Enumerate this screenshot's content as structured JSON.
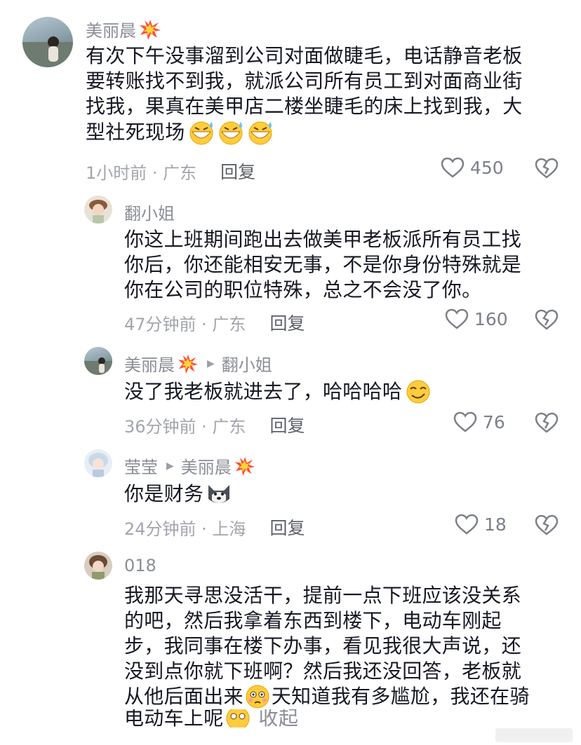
{
  "comments": [
    {
      "name": "美丽晨",
      "name_emoji": "boom-icon",
      "text_lines": [
        "有次下午没事溜到公司对面做睫毛，电话静音老板",
        "要转账找不到我，就派公司所有员工到对面商业街",
        "找我，果真在美甲店二楼坐睫毛的床上找到我，大",
        "型社死现场"
      ],
      "time": "1小时前 · 广东",
      "reply": "回复",
      "likes": "450"
    },
    {
      "name": "翻小姐",
      "text_lines": [
        "你这上班期间跑出去做美甲老板派所有员工找",
        "你后，你还能相安无事，不是你身份特殊就是",
        "你在公司的职位特殊，总之不会没了你。"
      ],
      "time": "47分钟前 · 广东",
      "reply": "回复",
      "likes": "160"
    },
    {
      "name": "美丽晨",
      "reply_to": "翻小姐",
      "text_lines": [
        "没了我老板就进去了，哈哈哈哈"
      ],
      "time": "36分钟前 · 广东",
      "reply": "回复",
      "likes": "76"
    },
    {
      "name": "莹莹",
      "reply_to": "美丽晨",
      "text_lines": [
        "你是财务"
      ],
      "time": "24分钟前 · 上海",
      "reply": "回复",
      "likes": "18"
    },
    {
      "name": "018",
      "text_lines": [
        "我那天寻思没活干，提前一点下班应该没关系",
        "的吧，然后我拿着东西到楼下，电动车刚起",
        "步，我同事在楼下办事，看见我很大声说，还",
        "没到点你就下班啊？然后我还没回答，老板就",
        "从他后面出来",
        "天知道我有多尴尬，我还在骑",
        "电动车上呢",
        "收起"
      ]
    }
  ],
  "colors": {
    "name": "#8a8e95",
    "text": "#161823",
    "meta": "#a2a5ab"
  }
}
